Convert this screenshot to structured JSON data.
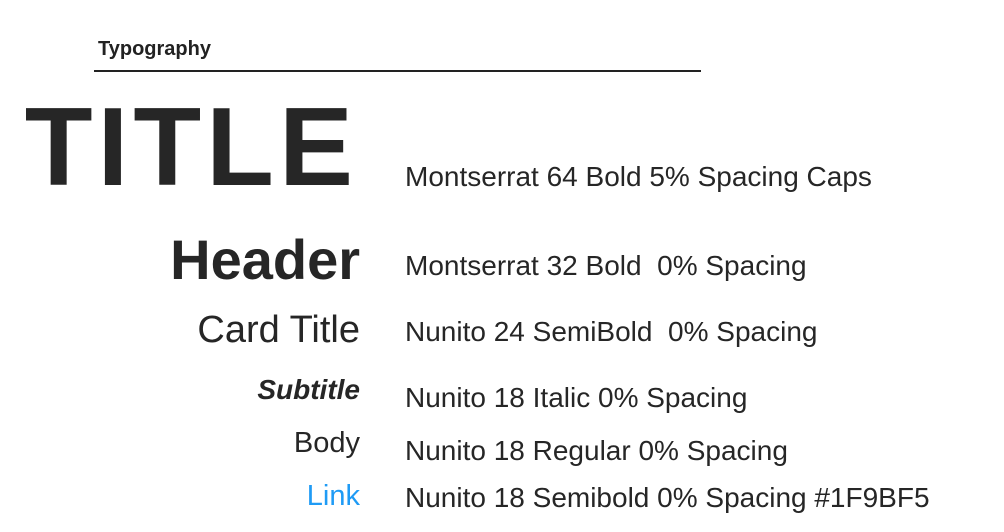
{
  "heading": "Typography",
  "link_color": "#1F9BF5",
  "rows": [
    {
      "label": "TITLE",
      "description": "Montserrat 64 Bold 5% Spacing Caps"
    },
    {
      "label": "Header",
      "description": "Montserrat 32 Bold  0% Spacing"
    },
    {
      "label": "Card Title",
      "description": "Nunito 24 SemiBold  0% Spacing"
    },
    {
      "label": "Subtitle",
      "description": "Nunito 18 Italic 0% Spacing"
    },
    {
      "label": "Body",
      "description": "Nunito 18 Regular 0% Spacing"
    },
    {
      "label": "Link",
      "description": "Nunito 18 Semibold 0% Spacing #1F9BF5"
    }
  ]
}
